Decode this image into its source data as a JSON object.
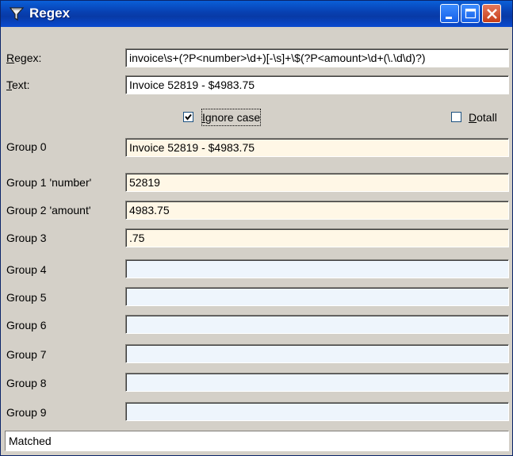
{
  "window": {
    "title": "Regex",
    "minimize_label": "Minimize",
    "maximize_label": "Maximize",
    "close_label": "Close"
  },
  "regex": {
    "label_accel": "R",
    "label_rest": "egex:",
    "value": "invoice\\s+(?P<number>\\d+)[-\\s]+\\$(?P<amount>\\d+(\\.\\d\\d)?)"
  },
  "text": {
    "label_accel": "T",
    "label_rest": "ext:",
    "value": "Invoice 52819 - $4983.75"
  },
  "options": {
    "ignore_case": {
      "accel": "I",
      "rest": "gnore case",
      "checked": true
    },
    "dotall": {
      "accel": "D",
      "rest": "otall",
      "checked": false
    }
  },
  "groups": [
    {
      "label": "Group 0",
      "value": "Invoice 52819 - $4983.75"
    },
    {
      "label": "Group 1 'number'",
      "value": "52819"
    },
    {
      "label": "Group 2 'amount'",
      "value": "4983.75"
    },
    {
      "label": "Group 3",
      "value": ".75"
    },
    {
      "label": "Group 4",
      "value": ""
    },
    {
      "label": "Group 5",
      "value": ""
    },
    {
      "label": "Group 6",
      "value": ""
    },
    {
      "label": "Group 7",
      "value": ""
    },
    {
      "label": "Group 8",
      "value": ""
    },
    {
      "label": "Group 9",
      "value": ""
    }
  ],
  "status": "Matched",
  "colors": {
    "filled_group_bg": "#fff7e6",
    "empty_group_bg": "#eef5fc",
    "titlebar": "#0842b4"
  }
}
